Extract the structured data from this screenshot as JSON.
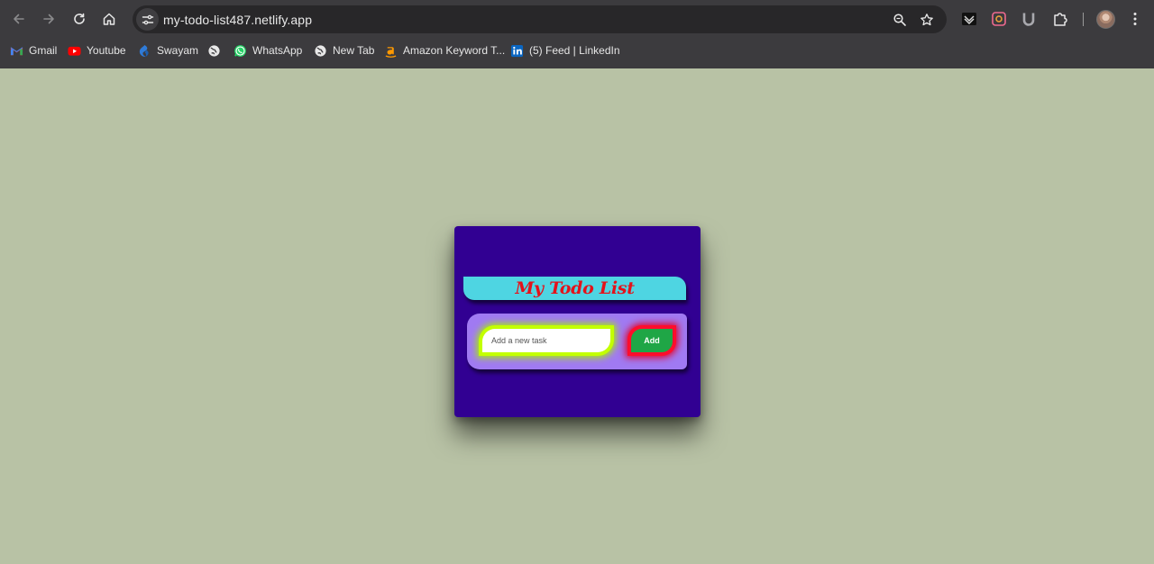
{
  "browser": {
    "url": "my-todo-list487.netlify.app",
    "bookmarks": [
      {
        "label": "Gmail",
        "icon": "gmail-icon"
      },
      {
        "label": "Youtube",
        "icon": "youtube-icon"
      },
      {
        "label": "Swayam",
        "icon": "swayam-icon"
      },
      {
        "label": "",
        "icon": "globe-icon"
      },
      {
        "label": "WhatsApp",
        "icon": "whatsapp-icon"
      },
      {
        "label": "New Tab",
        "icon": "globe-icon"
      },
      {
        "label": "Amazon Keyword T...",
        "icon": "amazon-icon"
      },
      {
        "label": "(5) Feed | LinkedIn",
        "icon": "linkedin-icon"
      }
    ]
  },
  "app": {
    "title": "My Todo List",
    "input_placeholder": "Add a new task",
    "input_value": "",
    "add_label": "Add"
  },
  "colors": {
    "page_background": "#b8c2a5",
    "card_background": "#310092",
    "title_bar": "#4ed5e2",
    "title_text": "#e4121a",
    "input_panel": "#a07af2",
    "input_glow": "#c3ff00",
    "add_button": "#1fa646",
    "add_button_glow": "#ff0d2c"
  }
}
